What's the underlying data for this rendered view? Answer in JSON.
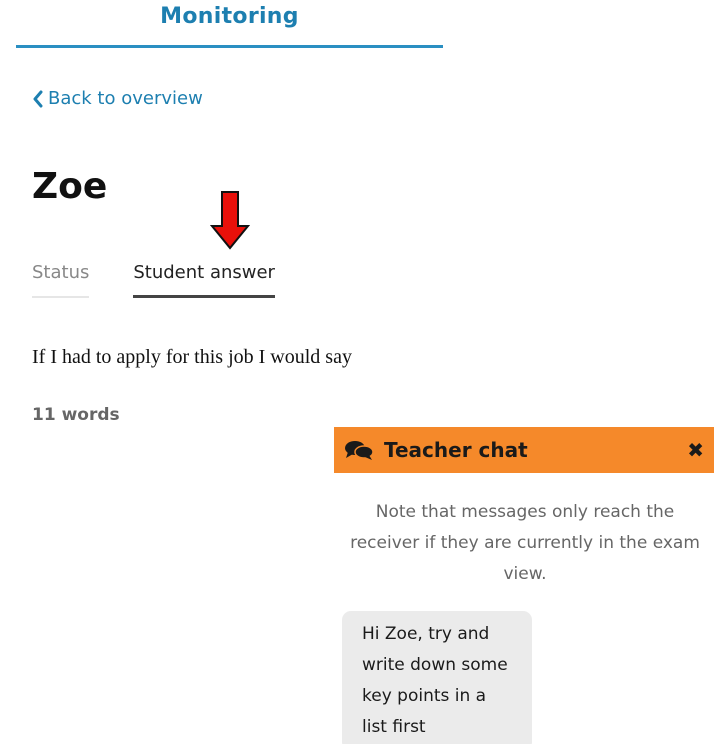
{
  "header": {
    "title": "Monitoring"
  },
  "nav": {
    "back_label": "Back to overview"
  },
  "student": {
    "name": "Zoe"
  },
  "tabs": [
    {
      "label": "Status",
      "active": false
    },
    {
      "label": "Student answer",
      "active": true
    }
  ],
  "answer": {
    "text": "If I had to apply for this job I would say",
    "word_count": "11 words"
  },
  "chat": {
    "title": "Teacher chat",
    "close_label": "✖",
    "note": "Note that messages only reach the receiver if they are currently in the exam view.",
    "messages": [
      {
        "text": "Hi Zoe, try and write down some key points in a list first"
      }
    ]
  },
  "colors": {
    "accent": "#1d7fb0",
    "chat_header": "#f5892a",
    "annotation_arrow": "#e8100a"
  },
  "icons": {
    "back": "chevron-left-icon",
    "chat": "comments-icon",
    "close": "close-icon",
    "annotation": "down-arrow-icon"
  }
}
